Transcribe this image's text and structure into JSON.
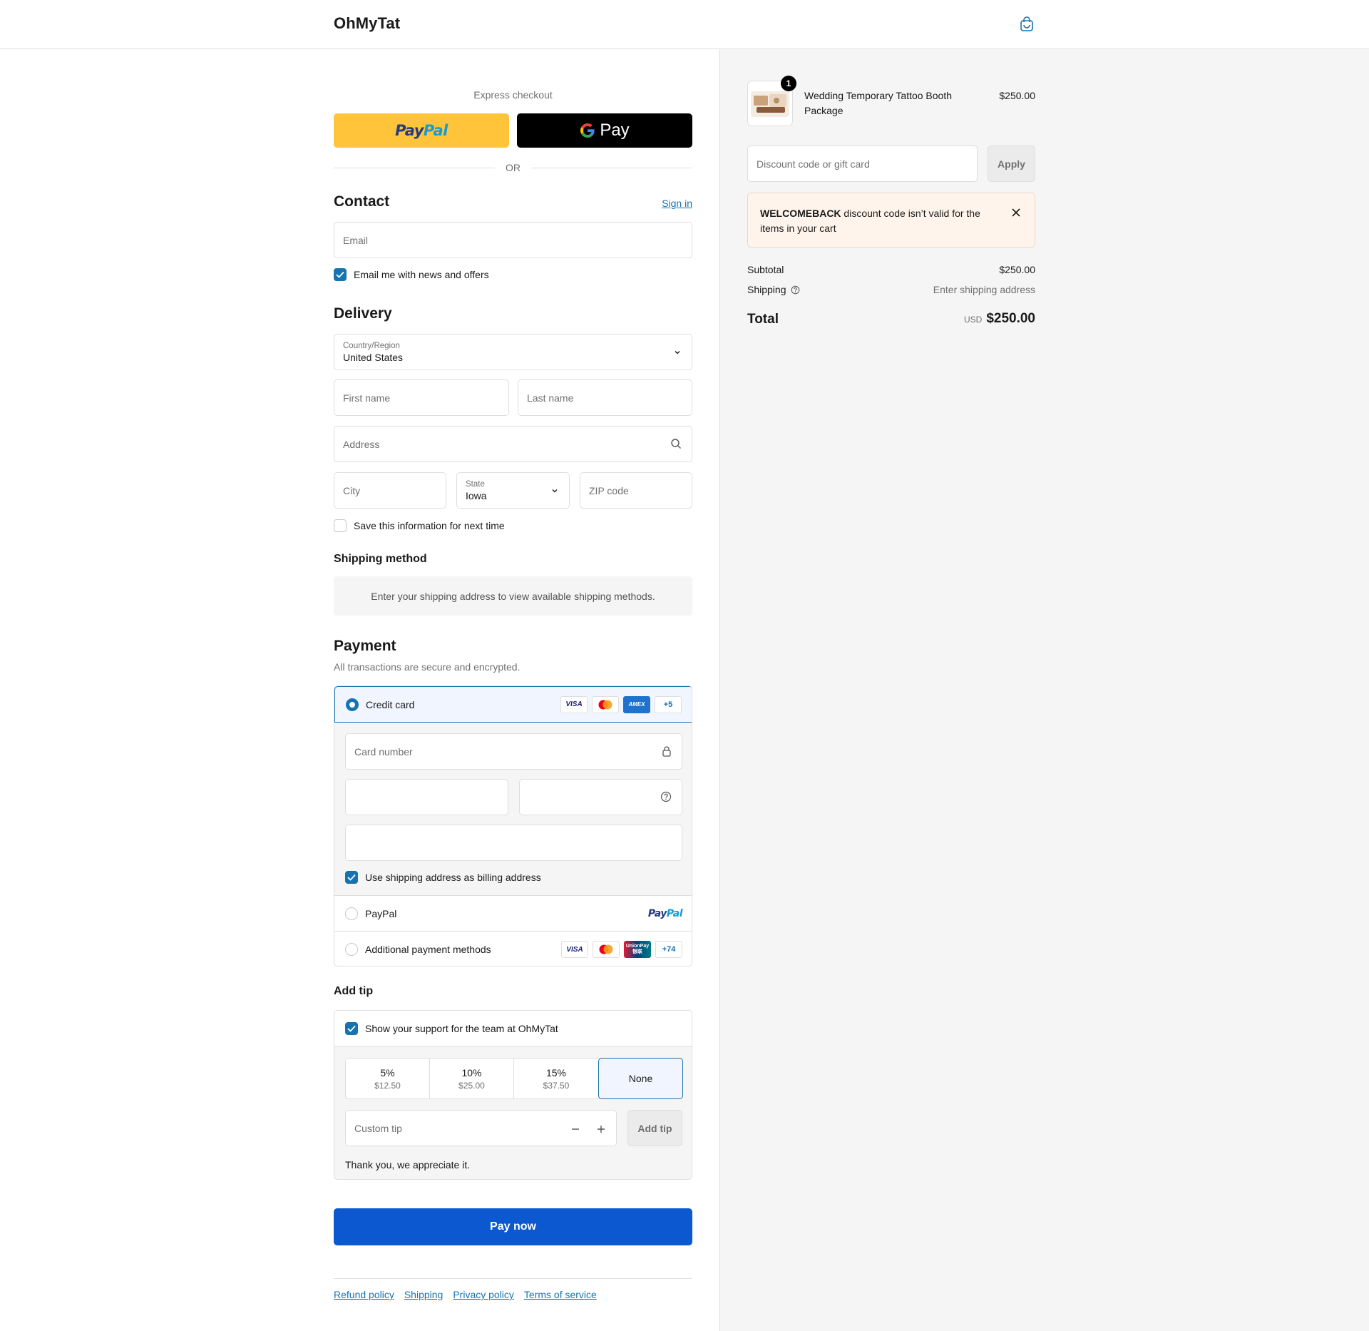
{
  "header": {
    "brand": "OhMyTat",
    "cart_icon": "shopping-bag-icon"
  },
  "express": {
    "title": "Express checkout",
    "paypal_part1": "Pay",
    "paypal_part2": "Pal",
    "gpay_label": "Pay",
    "or_label": "OR"
  },
  "contact": {
    "title": "Contact",
    "sign_in": "Sign in",
    "email_placeholder": "Email",
    "news_label": "Email me with news and offers",
    "news_checked": true
  },
  "delivery": {
    "title": "Delivery",
    "country_label": "Country/Region",
    "country_value": "United States",
    "first_name_placeholder": "First name",
    "last_name_placeholder": "Last name",
    "address_placeholder": "Address",
    "city_placeholder": "City",
    "state_label": "State",
    "state_value": "Iowa",
    "zip_placeholder": "ZIP code",
    "save_label": "Save this information for next time",
    "save_checked": false
  },
  "shipping_method": {
    "title": "Shipping method",
    "info": "Enter your shipping address to view available shipping methods."
  },
  "payment": {
    "title": "Payment",
    "subtitle": "All transactions are secure and encrypted.",
    "credit_card_label": "Credit card",
    "card_logos": [
      "VISA",
      "MC",
      "AMEX",
      "+5"
    ],
    "card_number_placeholder": "Card number",
    "billing_label": "Use shipping address as billing address",
    "billing_checked": true,
    "paypal_label": "PayPal",
    "additional_label": "Additional payment methods",
    "additional_logos": [
      "VISA",
      "MC",
      "UnionPay",
      "+74"
    ],
    "unionpay_text": "UnionPay",
    "unionpay_cn": "银联",
    "plus5": "+5",
    "plus74": "+74",
    "visa": "VISA",
    "amex": "AMEX"
  },
  "tip": {
    "title": "Add tip",
    "support_label": "Show your support for the team at OhMyTat",
    "support_checked": true,
    "options": [
      {
        "pct": "5%",
        "amount": "$12.50"
      },
      {
        "pct": "10%",
        "amount": "$25.00"
      },
      {
        "pct": "15%",
        "amount": "$37.50"
      },
      {
        "pct": "None",
        "amount": ""
      }
    ],
    "selected": "None",
    "custom_placeholder": "Custom tip",
    "add_button": "Add tip",
    "thanks": "Thank you, we appreciate it."
  },
  "pay_now": "Pay now",
  "footer": {
    "links": [
      "Refund policy",
      "Shipping",
      "Privacy policy",
      "Terms of service"
    ]
  },
  "summary": {
    "product_name": "Wedding Temporary Tattoo Booth Package",
    "product_price": "$250.00",
    "quantity": "1",
    "discount_placeholder": "Discount code or gift card",
    "apply": "Apply",
    "alert_code": "WELCOMEBACK",
    "alert_message": " discount code isn’t valid for the items in your cart",
    "subtotal_label": "Subtotal",
    "subtotal_value": "$250.00",
    "shipping_label": "Shipping",
    "shipping_value": "Enter shipping address",
    "total_label": "Total",
    "currency": "USD",
    "total_value": "$250.00"
  },
  "colors": {
    "accent": "#1773b0",
    "pay_button": "#0b58d1",
    "paypal_yellow": "#ffc439",
    "alert_bg": "#fff4ec"
  }
}
